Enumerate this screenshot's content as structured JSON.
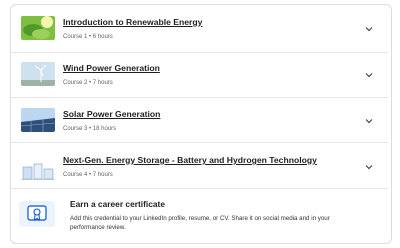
{
  "courses": [
    {
      "title": "Introduction to Renewable Energy",
      "meta": "Course 1 • 6 hours",
      "thumb_icon": "leaf-sun-icon"
    },
    {
      "title": "Wind Power Generation",
      "meta": "Course 2 • 7 hours",
      "thumb_icon": "wind-turbine-icon"
    },
    {
      "title": "Solar Power Generation",
      "meta": "Course 3 • 18 hours",
      "thumb_icon": "solar-panel-icon"
    },
    {
      "title": "Next-Gen. Energy Storage - Battery and Hydrogen Technology",
      "meta": "Course 4 • 7 hours",
      "thumb_icon": "battery-storage-icon"
    }
  ],
  "certificate": {
    "title": "Earn a career certificate",
    "description": "Add this credential to your LinkedIn profile, resume, or CV. Share it on social media and in your performance review.",
    "icon": "certificate-icon"
  },
  "colors": {
    "accent": "#0056d2",
    "border": "#dadce0",
    "muted": "#5f6368"
  }
}
